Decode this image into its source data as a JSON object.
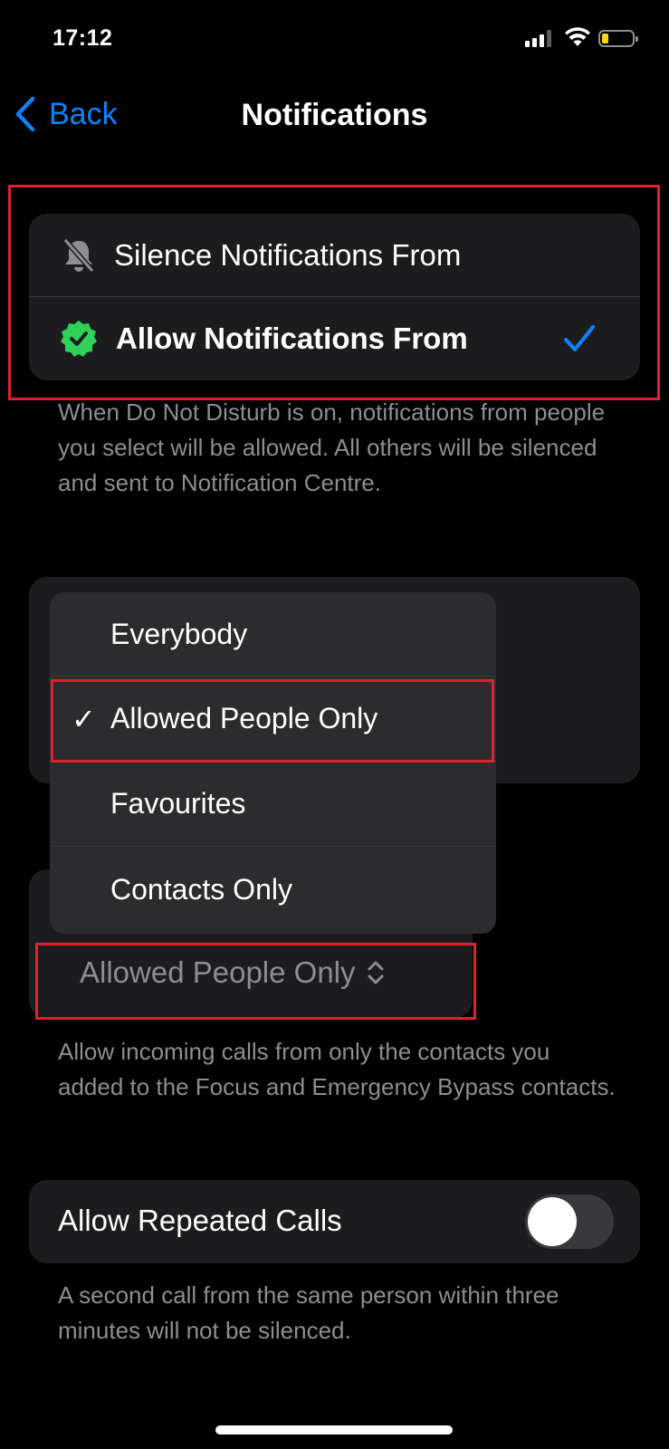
{
  "status_bar": {
    "time": "17:12"
  },
  "nav": {
    "back_label": "Back",
    "title": "Notifications"
  },
  "notification_mode": {
    "options": [
      {
        "label": "Silence Notifications From",
        "icon": "bell-slash-icon",
        "selected": false
      },
      {
        "label": "Allow Notifications From",
        "icon": "checkmark-seal-icon",
        "selected": true
      }
    ],
    "footer": "When Do Not Disturb is on, notifications from people you select will be allowed. All others will be silenced and sent to Notification Centre."
  },
  "calls_menu": {
    "items": [
      {
        "label": "Everybody",
        "selected": false
      },
      {
        "label": "Allowed People Only",
        "selected": true
      },
      {
        "label": "Favourites",
        "selected": false
      },
      {
        "label": "Contacts Only",
        "selected": false
      }
    ],
    "checkmark": "✓"
  },
  "calls_selector": {
    "value": "Allowed People Only"
  },
  "calls_footer": "Allow incoming calls from only the contacts you added to the Focus and Emergency Bypass contacts.",
  "repeated_calls": {
    "label": "Allow Repeated Calls",
    "enabled": false,
    "footer": "A second call from the same person within three minutes will not be silenced."
  },
  "colors": {
    "accent": "#0a84ff",
    "highlight": "#e0202a",
    "seal_green": "#30d158"
  }
}
